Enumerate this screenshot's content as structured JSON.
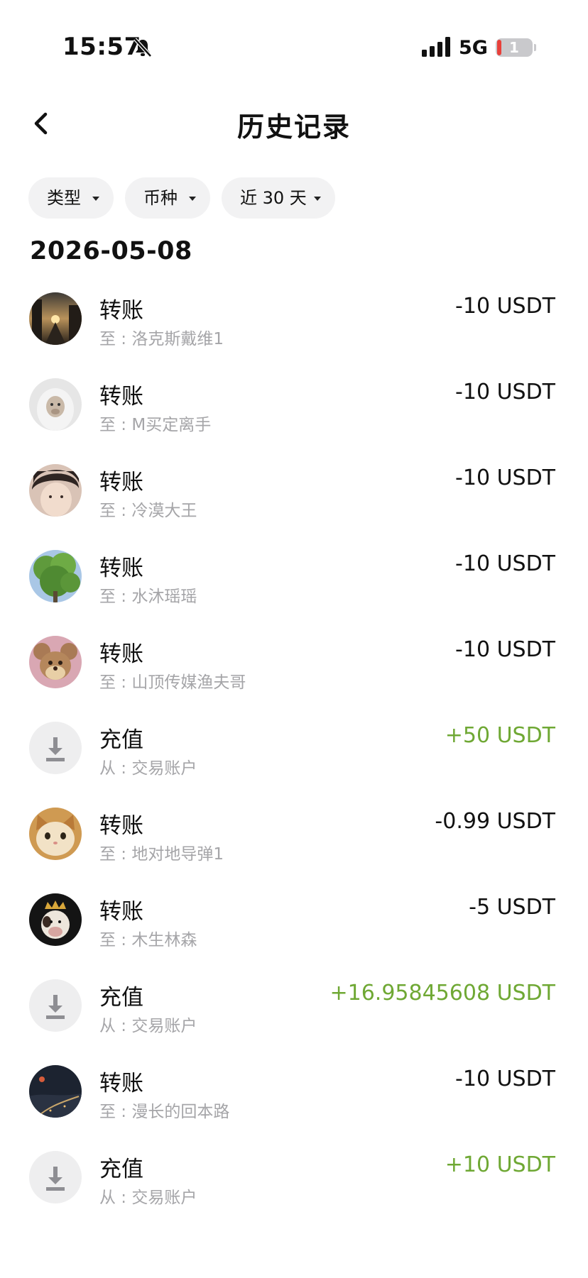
{
  "status_bar": {
    "time": "15:57",
    "network": "5G",
    "battery": "1"
  },
  "header": {
    "title": "历史记录"
  },
  "filters": [
    {
      "label": "类型"
    },
    {
      "label": "币种"
    },
    {
      "label": "近 30 天"
    }
  ],
  "date_group": "2026-05-08",
  "colors": {
    "positive": "#6fa834",
    "negative": "#111111",
    "secondary_text": "#a5a5a8",
    "chip_bg": "#f2f2f3"
  },
  "transactions": [
    {
      "type": "转账",
      "sub": "至 : 洛克斯戴维1",
      "amount": "-10 USDT",
      "avatar": "photo-city-sunset"
    },
    {
      "type": "转账",
      "sub": "至 : M买定离手",
      "amount": "-10 USDT",
      "avatar": "photo-monkey-hood"
    },
    {
      "type": "转账",
      "sub": "至 : 冷漠大王",
      "amount": "-10 USDT",
      "avatar": "photo-person-face"
    },
    {
      "type": "转账",
      "sub": "至 : 水沐瑶瑶",
      "amount": "-10 USDT",
      "avatar": "photo-tree"
    },
    {
      "type": "转账",
      "sub": "至 : 山顶传媒渔夫哥",
      "amount": "-10 USDT",
      "avatar": "photo-cartoon-mouse"
    },
    {
      "type": "充值",
      "sub": "从 : 交易账户",
      "amount": "+50 USDT",
      "avatar": "download-icon"
    },
    {
      "type": "转账",
      "sub": "至 : 地对地导弹1",
      "amount": "-0.99 USDT",
      "avatar": "photo-cat"
    },
    {
      "type": "转账",
      "sub": "至 : 木生林森",
      "amount": "-5 USDT",
      "avatar": "photo-crowned-cow"
    },
    {
      "type": "充值",
      "sub": "从 : 交易账户",
      "amount": "+16.95845608 USDT",
      "avatar": "download-icon"
    },
    {
      "type": "转账",
      "sub": "至 : 漫长的回本路",
      "amount": "-10 USDT",
      "avatar": "photo-night-road"
    },
    {
      "type": "充值",
      "sub": "从 : 交易账户",
      "amount": "+10 USDT",
      "avatar": "download-icon"
    }
  ]
}
